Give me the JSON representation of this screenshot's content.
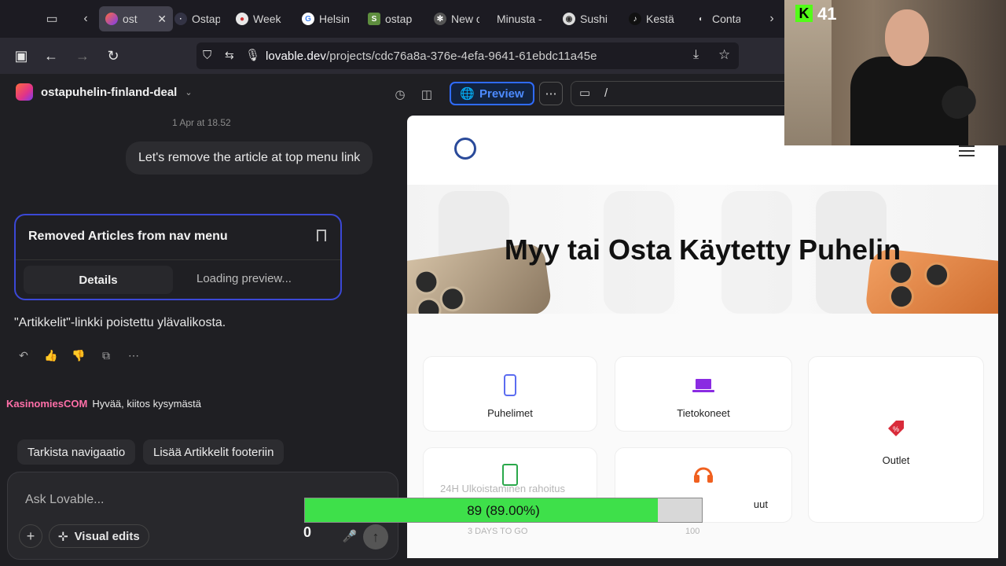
{
  "browser": {
    "tabs": [
      {
        "label": "ost",
        "active": true
      },
      {
        "label": "Ostap"
      },
      {
        "label": "Week"
      },
      {
        "label": "Helsin"
      },
      {
        "label": "ostap"
      },
      {
        "label": "New c"
      },
      {
        "label": "Minusta -"
      },
      {
        "label": "Sushi"
      },
      {
        "label": "Kestäv"
      },
      {
        "label": "Conta"
      }
    ],
    "url_host": "lovable.dev",
    "url_path": "/projects/cdc76a8a-376e-4efa-9641-61ebdc11a45e"
  },
  "project": {
    "name": "ostapuhelin-finland-deal"
  },
  "chat": {
    "timestamp": "1 Apr at 18.52",
    "user_message": "Let's remove the article at top menu link",
    "card_title": "Removed Articles from nav menu",
    "card_details": "Details",
    "card_loading": "Loading preview...",
    "reply": "\"Artikkelit\"-linkki poistettu ylävalikosta.",
    "suggestions": [
      "Tarkista navigaatio",
      "Lisää Artikkelit footeriin"
    ],
    "composer_placeholder": "Ask Lovable...",
    "visual_edits": "Visual edits"
  },
  "twitch_chat": {
    "user": "KasinomiesCOM",
    "message": "Hyvää, kiitos kysymästä"
  },
  "preview_header": {
    "preview_label": "Preview",
    "route": "/"
  },
  "site": {
    "hero_title": "Myy tai Osta Käytetty Puhelin",
    "categories": [
      {
        "label": "Puhelimet",
        "icon": "phone-icon",
        "color": "#5b6cf0"
      },
      {
        "label": "Tietokoneet",
        "icon": "laptop-icon",
        "color": "#8a2be2"
      },
      {
        "label": "Outlet",
        "icon": "tag-icon",
        "color": "#d92b3a"
      },
      {
        "label": "",
        "icon": "tablet-icon",
        "color": "#2aa84a"
      },
      {
        "label": "uut",
        "icon": "headphones-icon",
        "color": "#f0601f"
      }
    ]
  },
  "stream": {
    "kick_count": "41",
    "progress_value": 0.89,
    "progress_text": "89 (89.00%)",
    "overlay_zero": "0",
    "ghost_text_1": "24H Ulkoistaminen rahoitus",
    "ghost_text_2": "3 DAYS TO GO",
    "ghost_text_3": "100"
  },
  "colors": {
    "accent": "#2f6bff",
    "progress": "#3ee04a",
    "card_border": "#3b48d6"
  }
}
